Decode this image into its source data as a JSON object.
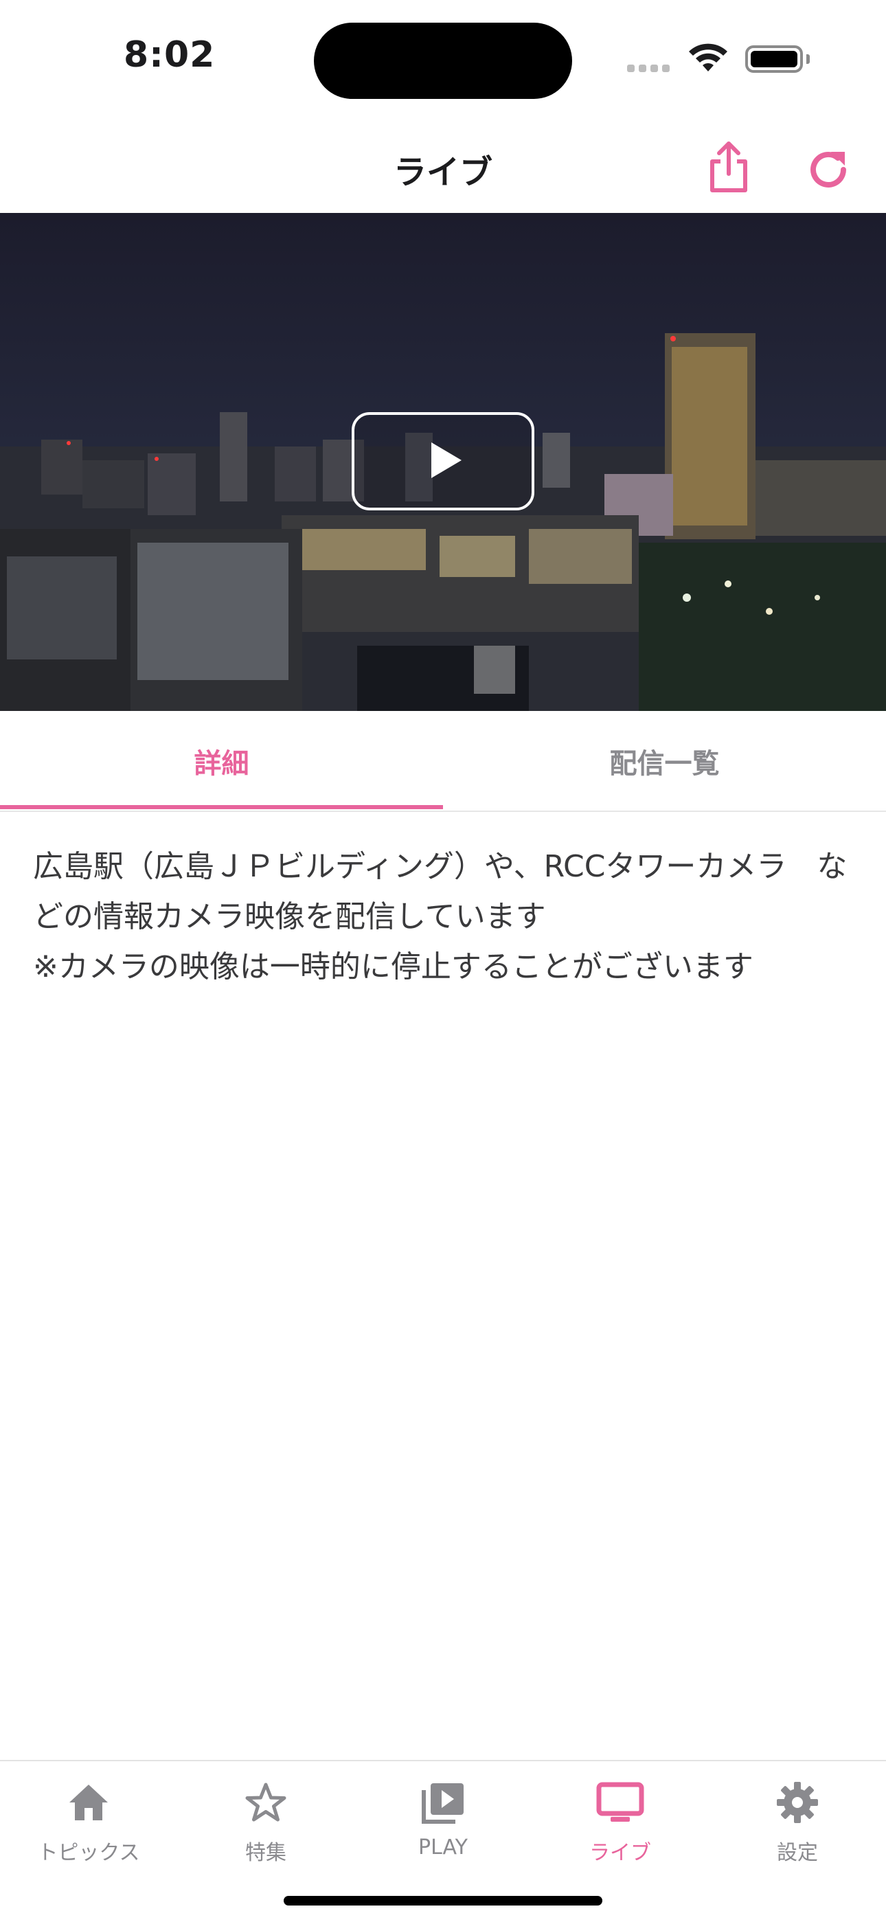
{
  "status_bar": {
    "time": "8:02"
  },
  "nav": {
    "title": "ライブ"
  },
  "accent_color": "#e8649c",
  "video": {
    "state": "paused"
  },
  "tabs": [
    {
      "label": "詳細",
      "active": true
    },
    {
      "label": "配信一覧",
      "active": false
    }
  ],
  "description": "広島駅（広島ＪＰビルディング）や、RCCタワーカメラ　などの情報カメラ映像を配信しています\n※カメラの映像は一時的に停止することがございます",
  "tabbar": {
    "items": [
      {
        "label": "トピックス",
        "icon": "home-icon"
      },
      {
        "label": "特集",
        "icon": "star-icon"
      },
      {
        "label": "PLAY",
        "icon": "video-library-icon"
      },
      {
        "label": "ライブ",
        "icon": "tv-icon",
        "active": true
      },
      {
        "label": "設定",
        "icon": "gear-icon"
      }
    ]
  }
}
